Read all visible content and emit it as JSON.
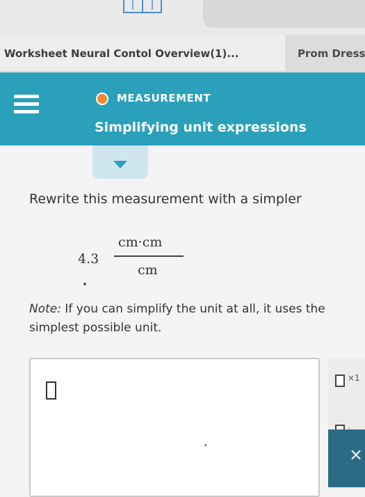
{
  "browser": {
    "tabs": [
      {
        "label": "Worksheet Neural Contol Overview(1)..."
      },
      {
        "label": "Prom Dress"
      }
    ]
  },
  "header": {
    "topic": "MEASUREMENT",
    "title": "Simplifying unit expressions",
    "topic_color": "#f28a2e",
    "bar_color": "#2aa0bb"
  },
  "question": {
    "instruction": "Rewrite this measurement with a simpler",
    "coefficient": "4.3",
    "numerator": "cm·cm",
    "denominator": "cm",
    "note_label": "Note:",
    "note_text": " If you can simplify the unit at all, it uses the simplest possible unit."
  },
  "tools": [
    {
      "icon": "superscript-box-icon",
      "suffix": "×1"
    },
    {
      "icon": "multiply-box-icon",
      "suffix": "·"
    }
  ],
  "actions": {
    "clear_label": "×"
  }
}
